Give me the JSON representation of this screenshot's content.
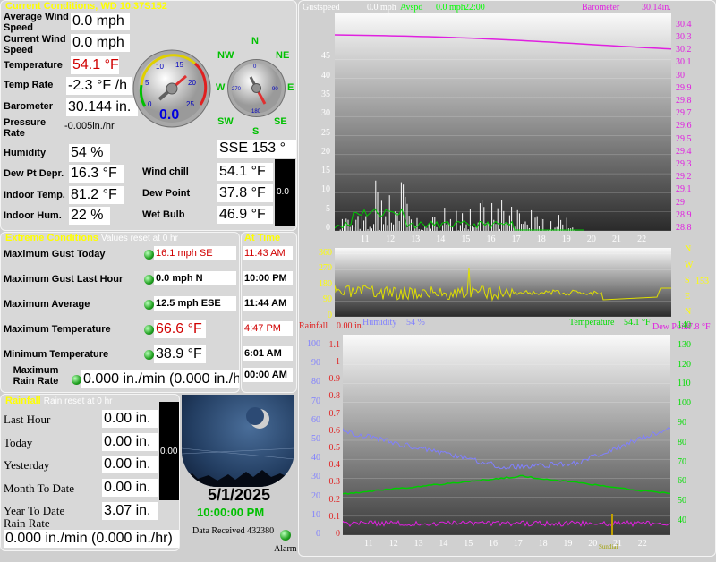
{
  "current": {
    "header": "Current Conditions, WD 10.37S152",
    "avg_wind_label": "Average Wind Speed",
    "avg_wind": "0.0 mph",
    "cur_wind_label": "Current Wind Speed",
    "cur_wind": "0.0 mph",
    "temp_label": "Temperature",
    "temp": "54.1 °F",
    "temp_rate_label": "Temp Rate",
    "temp_rate": "-2.3 °F /h",
    "baro_label": "Barometer",
    "baro": "30.144 in.",
    "press_rate_label": "Pressure Rate",
    "press_rate": "-0.005in./hr",
    "humidity_label": "Humidity",
    "humidity": "54 %",
    "dew_depr_label": "Dew Pt Depr.",
    "dew_depr": "16.3 °F",
    "indoor_temp_label": "Indoor Temp.",
    "indoor_temp": "81.2 °F",
    "indoor_hum_label": "Indoor Hum.",
    "indoor_hum": "22 %",
    "wind_dir": "SSE  153 °",
    "wind_chill_label": "Wind chill",
    "wind_chill": "54.1 °F",
    "dew_point_label": "Dew Point",
    "dew_point": "37.8 °F",
    "wet_bulb_label": "Wet Bulb",
    "wet_bulb": "46.9 °F",
    "bar_value": "0.0",
    "gauge_value": "0.0",
    "gauge_ticks": [
      "0",
      "5",
      "10",
      "15",
      "20",
      "25"
    ],
    "compass": {
      "n": "N",
      "ne": "NE",
      "e": "E",
      "se": "SE",
      "s": "S",
      "sw": "SW",
      "w": "W",
      "nw": "NW"
    },
    "compass_dial": [
      "0",
      "90",
      "180",
      "270"
    ]
  },
  "extreme": {
    "header": "Extreme Conditions",
    "note": "Values reset at 0 hr",
    "at_time_header": "At Time",
    "rows": [
      {
        "label": "Maximum Gust Today",
        "value": "16.1 mph  SE",
        "time": "11:43 AM",
        "red": true
      },
      {
        "label": "Maximum Gust Last Hour",
        "value": "0.0 mph  N",
        "time": "10:00 PM",
        "red": false
      },
      {
        "label": "Maximum Average",
        "value": "12.5 mph ESE",
        "time": "11:44 AM",
        "red": false
      },
      {
        "label": "Maximum Temperature",
        "value": "66.6 °F",
        "time": "4:47 PM",
        "red": true
      },
      {
        "label": "Minimum Temperature",
        "value": "38.9 °F",
        "time": "6:01 AM",
        "red": false
      },
      {
        "label": "Maximum Rain Rate",
        "value": "0.000 in./min (0.000 in./hr)",
        "time": "00:00 AM",
        "red": false
      }
    ]
  },
  "rainfall": {
    "header": "Rainfall",
    "note": "Rain reset at 0 hr",
    "rows": [
      {
        "label": "Last Hour",
        "value": "0.00 in."
      },
      {
        "label": "Today",
        "value": "0.00 in."
      },
      {
        "label": "Yesterday",
        "value": "0.00 in."
      },
      {
        "label": "Month To Date",
        "value": "0.00 in."
      },
      {
        "label": "Year To Date",
        "value": "3.07 in."
      }
    ],
    "rate_label": "Rain Rate",
    "rate": "0.000 in./min (0.000 in./hr)",
    "bar_value": "0.00"
  },
  "status": {
    "date": "5/1/2025",
    "time": "10:00:00 PM",
    "data_received": "Data Received 432380",
    "alarm": "Alarm"
  },
  "colors": {
    "header_yellow": "#ffff00",
    "temp_red": "#d00000",
    "ok_green": "#20a020",
    "baro": "#e020e0",
    "wind_line": "#ffffff",
    "avg_line": "#00cc00",
    "dir_line": "#e0e000",
    "humidity": "#8080ff",
    "temperature": "#00dd00",
    "dew_point": "#e020e0"
  },
  "charts": {
    "wind": {
      "gust_label": "Gustspeed",
      "gust": "0.0 mph",
      "avg_label": "Avspd",
      "avg": "0.0 mph",
      "time": "22:00",
      "baro_label": "Barometer",
      "baro": "30.14in.",
      "y_ticks": [
        "0",
        "5",
        "10",
        "15",
        "20",
        "25",
        "30",
        "35",
        "40",
        "45"
      ],
      "baro_ticks": [
        "28.8",
        "28.9",
        "29",
        "29.1",
        "29.2",
        "29.3",
        "29.4",
        "29.5",
        "29.6",
        "29.7",
        "29.8",
        "29.9",
        "30",
        "30.1",
        "30.2",
        "30.3",
        "30.4"
      ],
      "x_ticks": [
        "11",
        "12",
        "13",
        "14",
        "15",
        "16",
        "17",
        "18",
        "19",
        "20",
        "21",
        "22"
      ]
    },
    "dir": {
      "y_ticks": [
        "0",
        "90",
        "180",
        "270",
        "360"
      ],
      "side": [
        "N",
        "W",
        "S",
        "E",
        "N"
      ],
      "side_value": "153"
    },
    "env": {
      "rain_label": "Rainfall",
      "rain": "0.00 in.",
      "hum_label": "Humidity",
      "hum": "54 %",
      "temp_label": "Temperature",
      "temp": "54.1 °F",
      "dew_label": "Dew Point",
      "dew": "37.8 °F",
      "sundial": "Sundial",
      "rain_ticks": [
        "0",
        "0.1",
        "0.2",
        "0.3",
        "0.4",
        "0.5",
        "0.6",
        "0.7",
        "0.8",
        "0.9",
        "1",
        "1.1"
      ],
      "hum_ticks": [
        "0",
        "10",
        "20",
        "30",
        "40",
        "50",
        "60",
        "70",
        "80",
        "90",
        "100"
      ],
      "temp_ticks": [
        "40",
        "50",
        "60",
        "70",
        "80",
        "90",
        "100",
        "110",
        "120",
        "130",
        "140"
      ],
      "x_ticks": [
        "11",
        "12",
        "13",
        "14",
        "15",
        "16",
        "17",
        "18",
        "19",
        "20",
        "21",
        "22"
      ]
    }
  }
}
